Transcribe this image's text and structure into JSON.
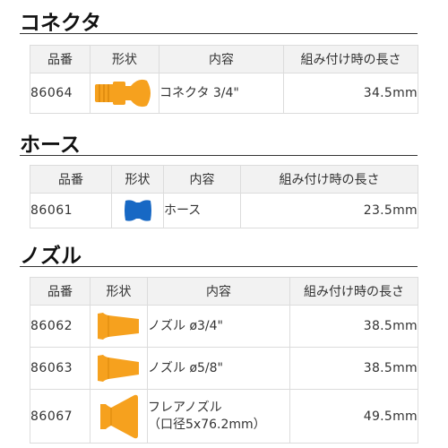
{
  "colors": {
    "orange": "#f6a11e",
    "orange_dark": "#d9860a",
    "blue": "#1768c4",
    "header_bg": "#f2f2f2",
    "border": "#dcdcdc"
  },
  "sections": [
    {
      "title": "コネクタ",
      "headers": [
        "品番",
        "形状",
        "内容",
        "組み付け時の長さ"
      ],
      "rows": [
        {
          "code": "86064",
          "shape_icon": "connector-icon",
          "content": [
            "コネクタ 3/4\""
          ],
          "length": "34.5mm"
        }
      ]
    },
    {
      "title": "ホース",
      "headers": [
        "品番",
        "形状",
        "内容",
        "組み付け時の長さ"
      ],
      "rows": [
        {
          "code": "86061",
          "shape_icon": "hose-segment-icon",
          "content": [
            "ホース"
          ],
          "length": "23.5mm"
        }
      ]
    },
    {
      "title": "ノズル",
      "headers": [
        "品番",
        "形状",
        "内容",
        "組み付け時の長さ"
      ],
      "rows": [
        {
          "code": "86062",
          "shape_icon": "round-nozzle-icon",
          "content": [
            "ノズル ø3/4\""
          ],
          "length": "38.5mm"
        },
        {
          "code": "86063",
          "shape_icon": "round-nozzle-icon",
          "content": [
            "ノズル ø5/8\""
          ],
          "length": "38.5mm"
        },
        {
          "code": "86067",
          "shape_icon": "flare-nozzle-icon",
          "content": [
            "フレアノズル",
            "（口径5x76.2mm）"
          ],
          "length": "49.5mm"
        }
      ]
    }
  ]
}
